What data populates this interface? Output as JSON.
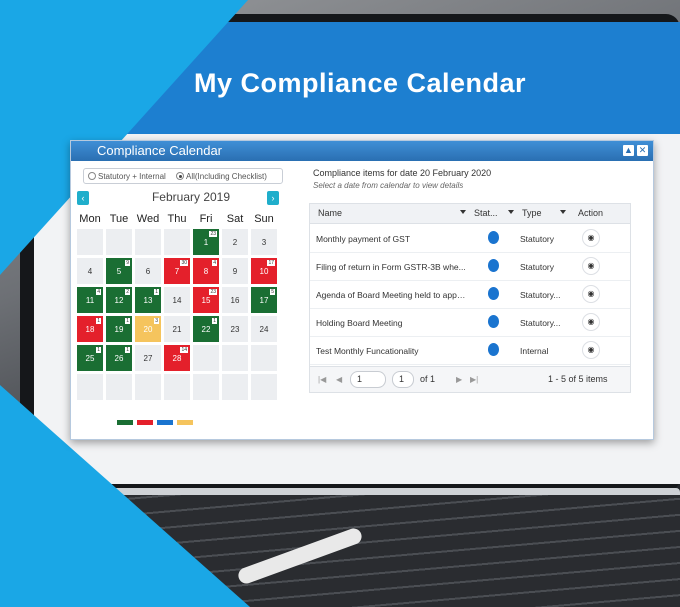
{
  "banner_title": "My Compliance Calendar",
  "window": {
    "title": "Compliance Calendar"
  },
  "filters": {
    "statutory_internal": "Statutory + Internal",
    "all_checklist": "All(Including Checklist)"
  },
  "calendar": {
    "month": "February 2019",
    "weekdays": [
      "Mon",
      "Tue",
      "Wed",
      "Thu",
      "Fri",
      "Sat",
      "Sun"
    ],
    "days": [
      {
        "d": "1",
        "badge": "23"
      },
      {
        "d": "2",
        "badge": ""
      },
      {
        "d": "3",
        "badge": ""
      },
      {
        "d": "4",
        "badge": ""
      },
      {
        "d": "5",
        "badge": "9"
      },
      {
        "d": "6",
        "badge": ""
      },
      {
        "d": "7",
        "badge": "30"
      },
      {
        "d": "8",
        "badge": "4"
      },
      {
        "d": "9",
        "badge": ""
      },
      {
        "d": "10",
        "badge": "17"
      },
      {
        "d": "11",
        "badge": "4"
      },
      {
        "d": "12",
        "badge": "2"
      },
      {
        "d": "13",
        "badge": "1"
      },
      {
        "d": "14",
        "badge": ""
      },
      {
        "d": "15",
        "badge": "23"
      },
      {
        "d": "16",
        "badge": ""
      },
      {
        "d": "17",
        "badge": "5"
      },
      {
        "d": "18",
        "badge": "1"
      },
      {
        "d": "19",
        "badge": "1"
      },
      {
        "d": "20",
        "badge": "3"
      },
      {
        "d": "21",
        "badge": ""
      },
      {
        "d": "22",
        "badge": "1"
      },
      {
        "d": "23",
        "badge": ""
      },
      {
        "d": "24",
        "badge": ""
      },
      {
        "d": "25",
        "badge": "1"
      },
      {
        "d": "26",
        "badge": "1"
      },
      {
        "d": "27",
        "badge": ""
      },
      {
        "d": "28",
        "badge": "14"
      }
    ],
    "legend_colors": [
      "#1a6e33",
      "#e4202b",
      "#1a74cf",
      "#f5c45d"
    ]
  },
  "details": {
    "header": "Compliance items for date 20 February 2020",
    "hint": "Select a date from calendar to view details",
    "columns": [
      "Name",
      "Stat...",
      "Type",
      "Action"
    ],
    "rows": [
      {
        "name": "Monthly payment of GST",
        "type": "Statutory"
      },
      {
        "name": "Filing of return in Form GSTR-3B whe...",
        "type": "Statutory"
      },
      {
        "name": "Agenda of Board Meeting held to appr...",
        "type": "Statutory..."
      },
      {
        "name": "Holding Board Meeting",
        "type": "Statutory..."
      },
      {
        "name": "Test Monthly Funcationality",
        "type": "Internal"
      }
    ],
    "pager": {
      "page": "1",
      "page_size": "1",
      "of": "of 1",
      "summary": "1 - 5 of 5 items"
    }
  },
  "icons": {
    "eye": "eye-icon",
    "prev": "chevron-left-icon",
    "next": "chevron-right-icon"
  }
}
